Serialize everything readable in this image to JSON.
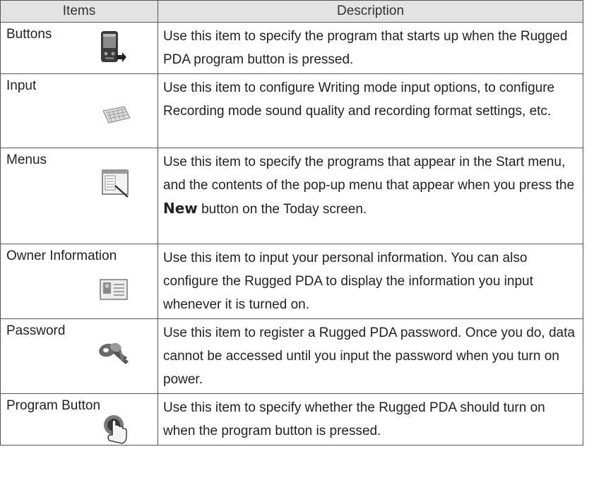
{
  "table": {
    "headers": {
      "items": "Items",
      "description": "Description"
    },
    "rows": [
      {
        "item": "Buttons",
        "icon": "pda-device-icon",
        "description": "Use this item to specify the program that starts up when the Rugged PDA program button is pressed."
      },
      {
        "item": "Input",
        "icon": "keyboard-icon",
        "description": "Use this item to configure Writing mode input options, to configure Recording mode sound quality and recording format settings, etc."
      },
      {
        "item": "Menus",
        "icon": "menu-window-icon",
        "description_before": "Use this item to specify the programs that appear in the Start menu, and the contents of the pop-up menu that appear when you press the",
        "description_bold": "New",
        "description_after": "button on the Today screen."
      },
      {
        "item": "Owner Information",
        "icon": "id-card-icon",
        "description": "Use this item to input your personal information. You can also configure the Rugged PDA to display the information you input whenever it is turned on."
      },
      {
        "item": "Password",
        "icon": "keys-icon",
        "description": "Use this item to register a Rugged PDA password. Once you do, data cannot be accessed until you input the password when you turn on power."
      },
      {
        "item": "Program Button",
        "icon": "hand-press-button-icon",
        "description": "Use this item to specify whether the Rugged PDA should turn on when the program button is pressed."
      }
    ]
  }
}
